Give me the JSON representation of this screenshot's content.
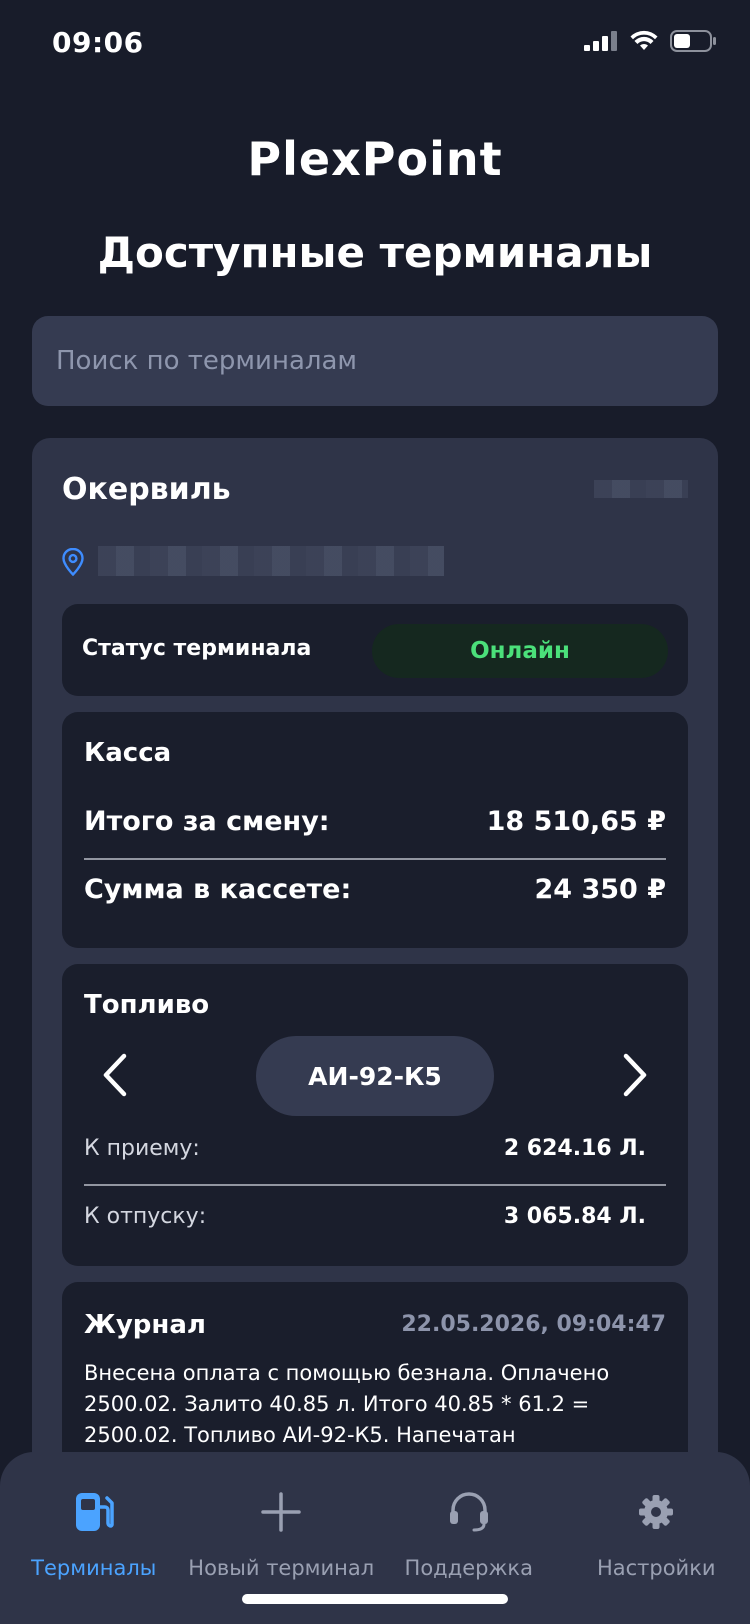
{
  "status_bar": {
    "time": "09:06"
  },
  "logo": {
    "text": "PlexPoint"
  },
  "page_title": "Доступные терминалы",
  "search": {
    "placeholder": "Поиск по терминалам",
    "value": ""
  },
  "terminal": {
    "name": "Окервиль",
    "status": {
      "label": "Статус терминала",
      "value": "Онлайн",
      "color": "#4be07a"
    },
    "cash": {
      "title": "Касса",
      "shift_total_label": "Итого за смену:",
      "shift_total_value": "18 510,65 ₽",
      "cassette_label": "Сумма в кассете:",
      "cassette_value": "24 350 ₽"
    },
    "fuel": {
      "title": "Топливо",
      "selected": "АИ-92-К5",
      "receive_label": "К приему:",
      "receive_value": "2 624.16 Л.",
      "release_label": "К отпуску:",
      "release_value": "3 065.84 Л."
    },
    "journal": {
      "title": "Журнал",
      "date": "22.05.2026, 09:04:47",
      "text": "Внесена оплата с помощью безнала. Оплачено 2500.02. Залито 40.85 л. Итого 40.85 * 61.2 = 2500.02. Топливо АИ-92-К5. Напечатан"
    }
  },
  "tabbar": {
    "items": [
      {
        "label": "Терминалы",
        "icon": "fuel-pump-icon",
        "active": true
      },
      {
        "label": "Новый терминал",
        "icon": "plus-icon",
        "active": false
      },
      {
        "label": "Поддержка",
        "icon": "headset-icon",
        "active": false
      },
      {
        "label": "Настройки",
        "icon": "gear-icon",
        "active": false
      }
    ]
  },
  "colors": {
    "background": "#181c2a",
    "card": "#2f3448",
    "panel": "#1a1e2c",
    "accent": "#4ba3ff",
    "online": "#4be07a"
  }
}
